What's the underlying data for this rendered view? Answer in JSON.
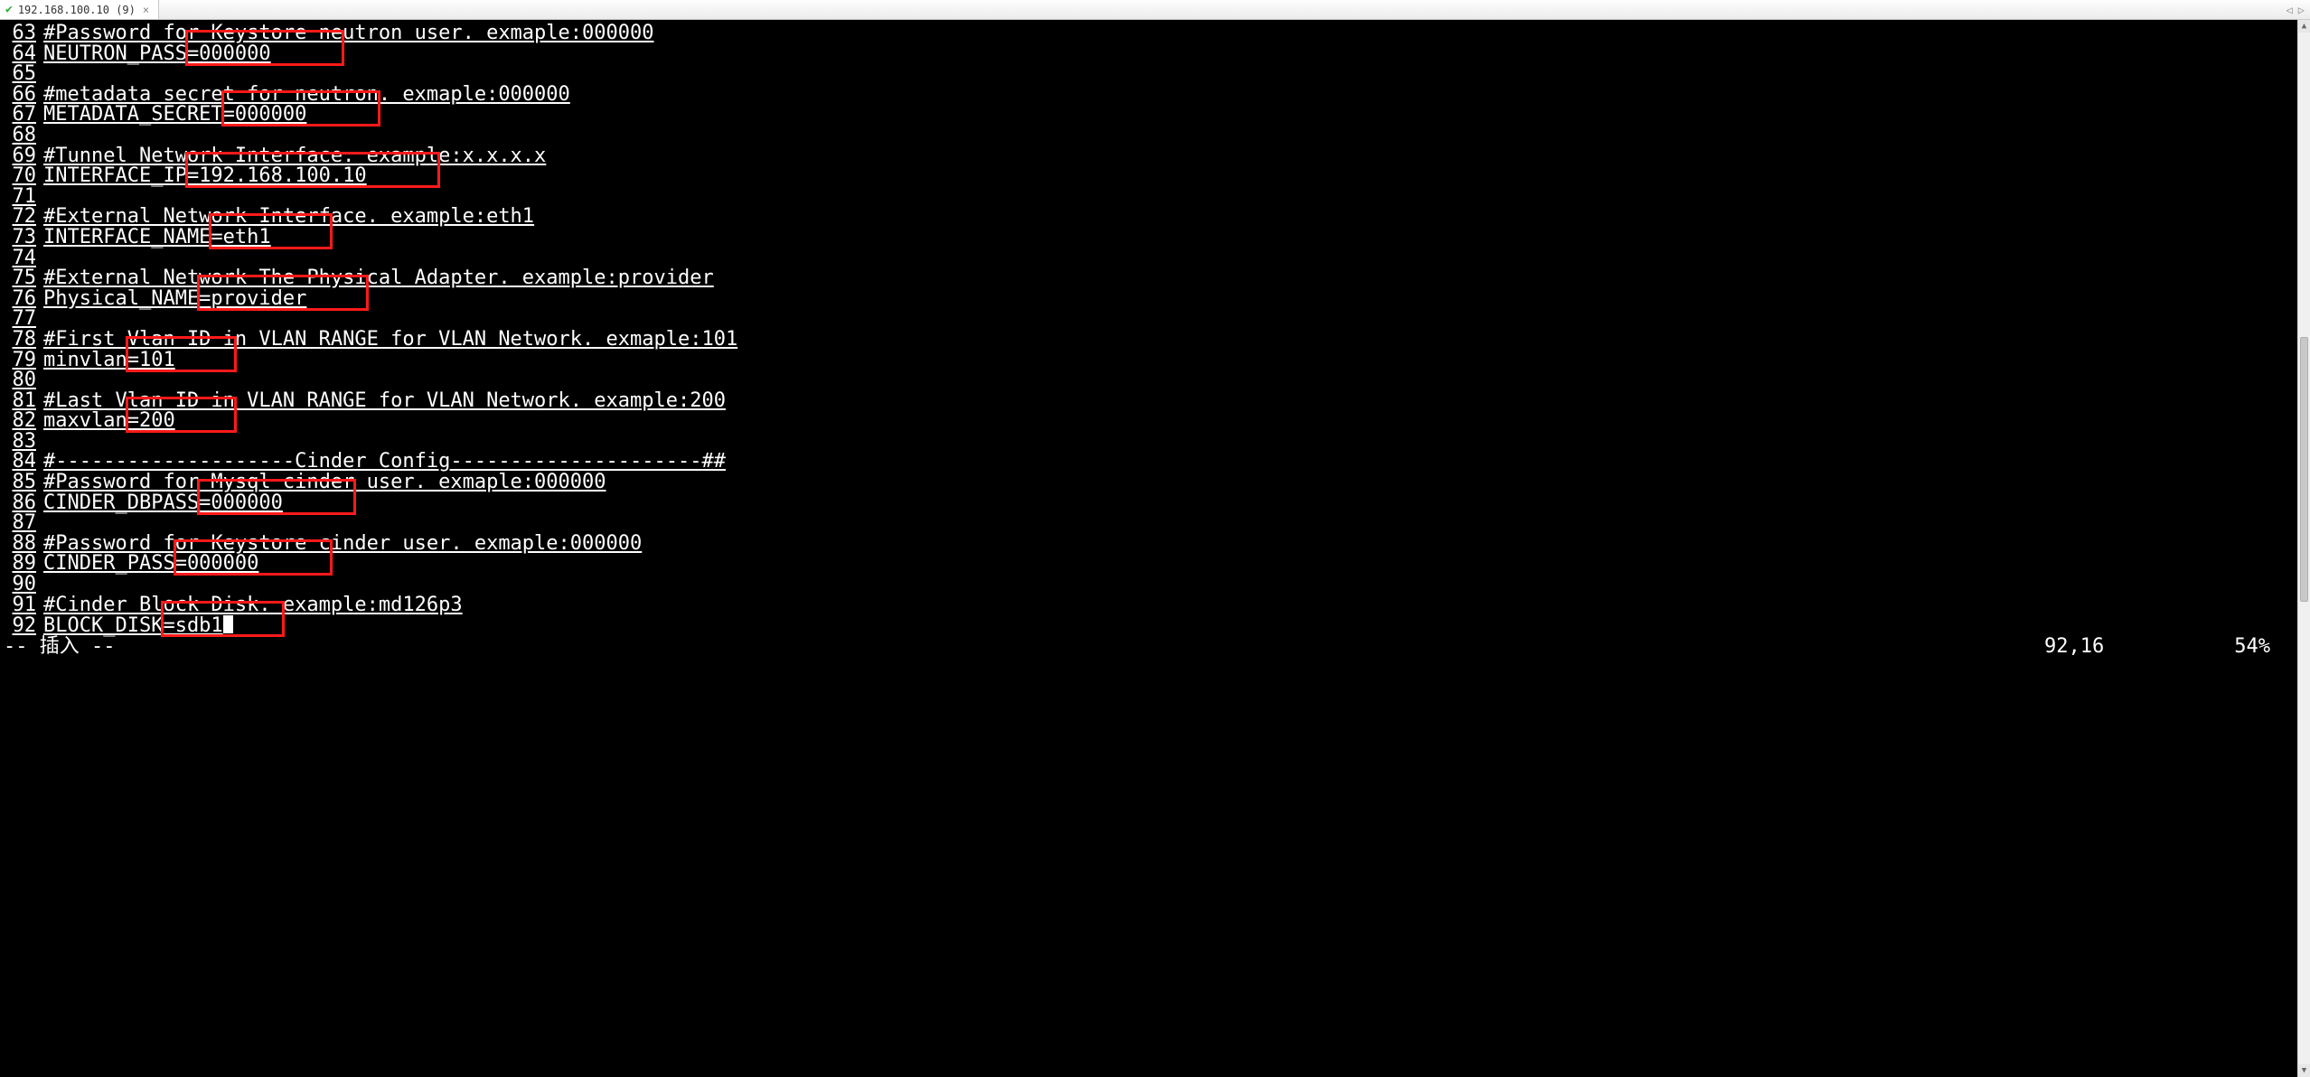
{
  "tab": {
    "title": "192.168.100.10 (9)",
    "saved_icon": "✔",
    "close_icon": "×"
  },
  "tabbar_nav": {
    "left": "◁",
    "right": "▷"
  },
  "status": {
    "mode": "-- 插入 --",
    "position": "92,16",
    "percent": "54%"
  },
  "cursor_line": 92,
  "lines": [
    {
      "n": 63,
      "text": "#Password for Keystore neutron user. exmaple:000000"
    },
    {
      "n": 64,
      "text": "NEUTRON_PASS=000000"
    },
    {
      "n": 65,
      "text": ""
    },
    {
      "n": 66,
      "text": "#metadata secret for neutron. exmaple:000000"
    },
    {
      "n": 67,
      "text": "METADATA_SECRET=000000"
    },
    {
      "n": 68,
      "text": ""
    },
    {
      "n": 69,
      "text": "#Tunnel Network Interface. example:x.x.x.x"
    },
    {
      "n": 70,
      "text": "INTERFACE_IP=192.168.100.10"
    },
    {
      "n": 71,
      "text": ""
    },
    {
      "n": 72,
      "text": "#External Network Interface. example:eth1"
    },
    {
      "n": 73,
      "text": "INTERFACE_NAME=eth1"
    },
    {
      "n": 74,
      "text": ""
    },
    {
      "n": 75,
      "text": "#External Network The Physical Adapter. example:provider"
    },
    {
      "n": 76,
      "text": "Physical_NAME=provider"
    },
    {
      "n": 77,
      "text": ""
    },
    {
      "n": 78,
      "text": "#First Vlan ID in VLAN RANGE for VLAN Network. exmaple:101"
    },
    {
      "n": 79,
      "text": "minvlan=101"
    },
    {
      "n": 80,
      "text": ""
    },
    {
      "n": 81,
      "text": "#Last Vlan ID in VLAN RANGE for VLAN Network. example:200"
    },
    {
      "n": 82,
      "text": "maxvlan=200"
    },
    {
      "n": 83,
      "text": ""
    },
    {
      "n": 84,
      "text": "#--------------------Cinder Config---------------------##"
    },
    {
      "n": 85,
      "text": "#Password for Mysql cinder user. exmaple:000000"
    },
    {
      "n": 86,
      "text": "CINDER_DBPASS=000000"
    },
    {
      "n": 87,
      "text": ""
    },
    {
      "n": 88,
      "text": "#Password for Keystore cinder user. exmaple:000000"
    },
    {
      "n": 89,
      "text": "CINDER_PASS=000000"
    },
    {
      "n": 90,
      "text": ""
    },
    {
      "n": 91,
      "text": "#Cinder Block Disk. example:md126p3"
    },
    {
      "n": 92,
      "text": "BLOCK_DISK=sdb1"
    }
  ],
  "highlights": [
    {
      "line": 64,
      "col_start": 13,
      "col_end": 25
    },
    {
      "line": 67,
      "col_start": 16,
      "col_end": 28
    },
    {
      "line": 70,
      "col_start": 13,
      "col_end": 33
    },
    {
      "line": 73,
      "col_start": 15,
      "col_end": 24
    },
    {
      "line": 76,
      "col_start": 14,
      "col_end": 27
    },
    {
      "line": 79,
      "col_start": 8,
      "col_end": 16
    },
    {
      "line": 82,
      "col_start": 8,
      "col_end": 16
    },
    {
      "line": 86,
      "col_start": 14,
      "col_end": 26
    },
    {
      "line": 89,
      "col_start": 12,
      "col_end": 24
    },
    {
      "line": 92,
      "col_start": 11,
      "col_end": 20
    }
  ]
}
